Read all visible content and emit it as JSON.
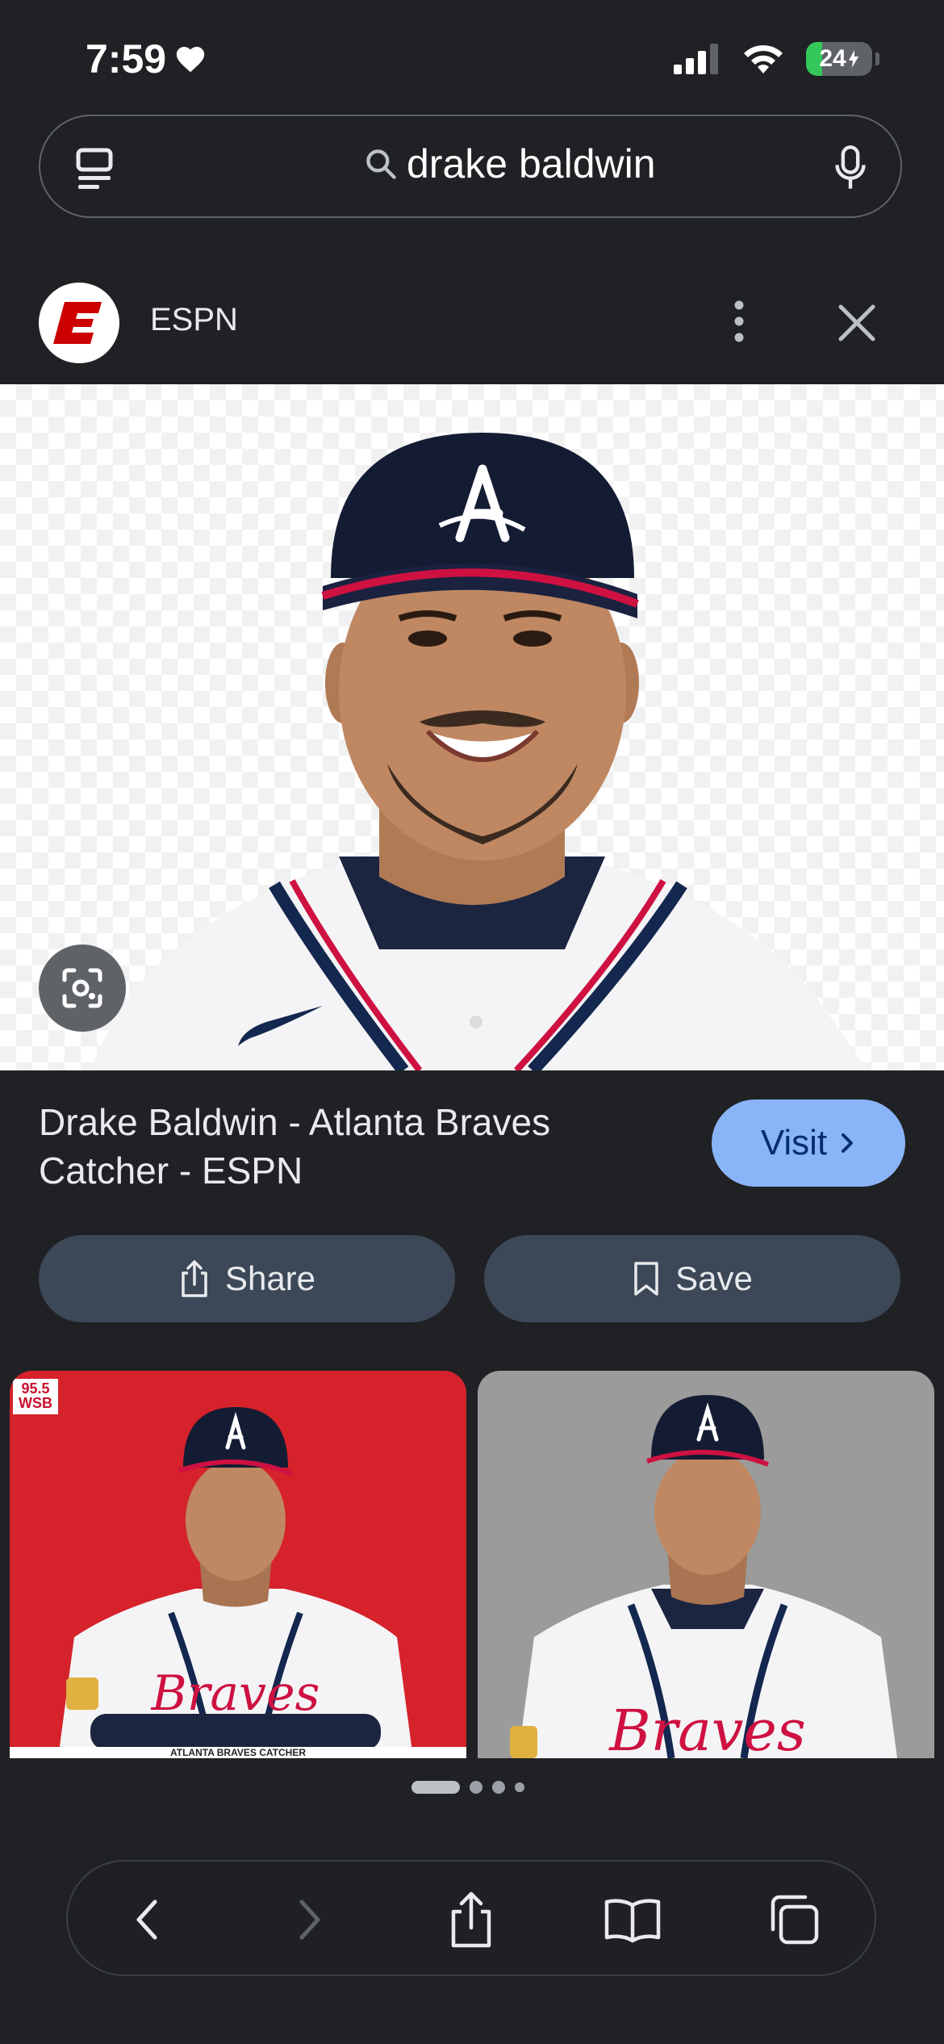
{
  "status_bar": {
    "time": "7:59",
    "battery": "24"
  },
  "search": {
    "query": "drake baldwin"
  },
  "source": {
    "name": "ESPN",
    "logo_letter": "E"
  },
  "result": {
    "title": "Drake Baldwin - Atlanta Braves Catcher - ESPN",
    "visit_label": "Visit"
  },
  "actions": {
    "share_label": "Share",
    "save_label": "Save"
  },
  "related": {
    "left_badge_top": "95.5",
    "left_badge_bottom": "WSB",
    "left_caption": "ATLANTA BRAVES CATCHER"
  },
  "colors": {
    "background": "#202124",
    "visit_button": "#8ab4f8",
    "pill_button": "#3c4858",
    "espn_red": "#cc0000",
    "braves_navy": "#13274f",
    "braves_red": "#ce1141"
  },
  "icons": {
    "tab_switcher": "tab-switcher-icon",
    "search": "search-icon",
    "mic": "mic-icon",
    "more": "more-vert-icon",
    "close": "close-icon",
    "lens": "lens-icon",
    "share": "share-icon",
    "save": "bookmark-icon",
    "back": "back-icon",
    "forward": "forward-icon",
    "bookmarks": "book-icon",
    "tabs": "tabs-icon"
  }
}
